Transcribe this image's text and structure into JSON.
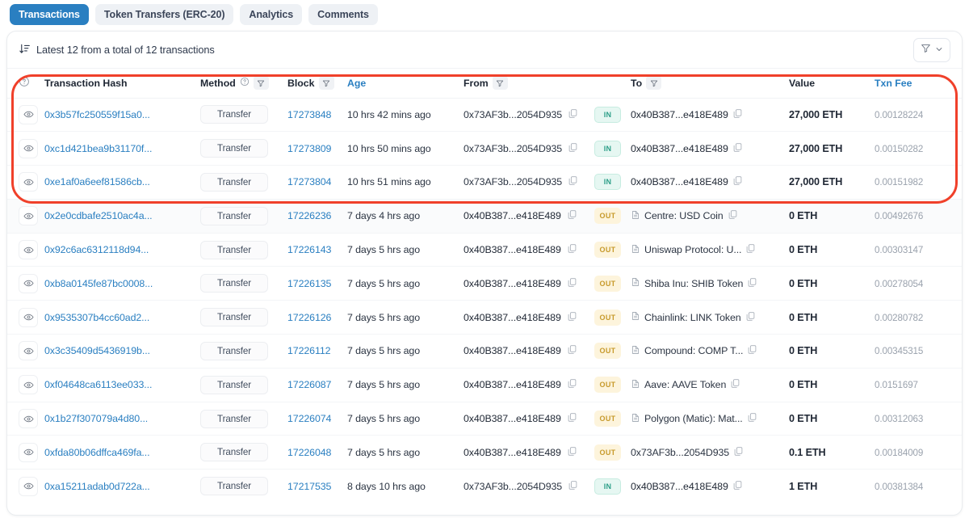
{
  "tabs": [
    {
      "label": "Transactions",
      "active": true
    },
    {
      "label": "Token Transfers (ERC-20)",
      "active": false
    },
    {
      "label": "Analytics",
      "active": false
    },
    {
      "label": "Comments",
      "active": false
    }
  ],
  "card": {
    "summary": "Latest 12 from a total of 12 transactions",
    "sort_icon": "sort-descending-icon",
    "filter_icon": "funnel-icon",
    "chevron_icon": "chevron-down-icon"
  },
  "table": {
    "headers": {
      "info": "",
      "hash": "Transaction Hash",
      "method": "Method",
      "block": "Block",
      "age": "Age",
      "from": "From",
      "dir": "",
      "to": "To",
      "value": "Value",
      "fee": "Txn Fee"
    },
    "rows": [
      {
        "hash": "0x3b57fc250559f15a0...",
        "method": "Transfer",
        "block": "17273848",
        "age": "10 hrs 42 mins ago",
        "from": "0x73AF3b...2054D935",
        "from_link": true,
        "dir": "IN",
        "to": "0x40B387...e418E489",
        "to_link": false,
        "to_is_token": false,
        "value": "27,000 ETH",
        "fee": "0.00128224",
        "highlight": false
      },
      {
        "hash": "0xc1d421bea9b31170f...",
        "method": "Transfer",
        "block": "17273809",
        "age": "10 hrs 50 mins ago",
        "from": "0x73AF3b...2054D935",
        "from_link": true,
        "dir": "IN",
        "to": "0x40B387...e418E489",
        "to_link": false,
        "to_is_token": false,
        "value": "27,000 ETH",
        "fee": "0.00150282",
        "highlight": false
      },
      {
        "hash": "0xe1af0a6eef81586cb...",
        "method": "Transfer",
        "block": "17273804",
        "age": "10 hrs 51 mins ago",
        "from": "0x73AF3b...2054D935",
        "from_link": true,
        "dir": "IN",
        "to": "0x40B387...e418E489",
        "to_link": false,
        "to_is_token": false,
        "value": "27,000 ETH",
        "fee": "0.00151982",
        "highlight": false
      },
      {
        "hash": "0x2e0cdbafe2510ac4a...",
        "method": "Transfer",
        "block": "17226236",
        "age": "7 days 4 hrs ago",
        "from": "0x40B387...e418E489",
        "from_link": false,
        "dir": "OUT",
        "to": "Centre: USD Coin",
        "to_link": true,
        "to_is_token": true,
        "value": "0 ETH",
        "fee": "0.00492676",
        "highlight": true
      },
      {
        "hash": "0x92c6ac6312118d94...",
        "method": "Transfer",
        "block": "17226143",
        "age": "7 days 5 hrs ago",
        "from": "0x40B387...e418E489",
        "from_link": false,
        "dir": "OUT",
        "to": "Uniswap Protocol: U...",
        "to_link": true,
        "to_is_token": true,
        "value": "0 ETH",
        "fee": "0.00303147",
        "highlight": false
      },
      {
        "hash": "0xb8a0145fe87bc0008...",
        "method": "Transfer",
        "block": "17226135",
        "age": "7 days 5 hrs ago",
        "from": "0x40B387...e418E489",
        "from_link": false,
        "dir": "OUT",
        "to": "Shiba Inu: SHIB Token",
        "to_link": true,
        "to_is_token": true,
        "value": "0 ETH",
        "fee": "0.00278054",
        "highlight": false
      },
      {
        "hash": "0x9535307b4cc60ad2...",
        "method": "Transfer",
        "block": "17226126",
        "age": "7 days 5 hrs ago",
        "from": "0x40B387...e418E489",
        "from_link": false,
        "dir": "OUT",
        "to": "Chainlink: LINK Token",
        "to_link": true,
        "to_is_token": true,
        "value": "0 ETH",
        "fee": "0.00280782",
        "highlight": false
      },
      {
        "hash": "0x3c35409d5436919b...",
        "method": "Transfer",
        "block": "17226112",
        "age": "7 days 5 hrs ago",
        "from": "0x40B387...e418E489",
        "from_link": false,
        "dir": "OUT",
        "to": "Compound: COMP T...",
        "to_link": true,
        "to_is_token": true,
        "value": "0 ETH",
        "fee": "0.00345315",
        "highlight": false
      },
      {
        "hash": "0xf04648ca6113ee033...",
        "method": "Transfer",
        "block": "17226087",
        "age": "7 days 5 hrs ago",
        "from": "0x40B387...e418E489",
        "from_link": false,
        "dir": "OUT",
        "to": "Aave: AAVE Token",
        "to_link": true,
        "to_is_token": true,
        "value": "0 ETH",
        "fee": "0.0151697",
        "highlight": false
      },
      {
        "hash": "0x1b27f307079a4d80...",
        "method": "Transfer",
        "block": "17226074",
        "age": "7 days 5 hrs ago",
        "from": "0x40B387...e418E489",
        "from_link": false,
        "dir": "OUT",
        "to": "Polygon (Matic): Mat...",
        "to_link": true,
        "to_is_token": true,
        "value": "0 ETH",
        "fee": "0.00312063",
        "highlight": false
      },
      {
        "hash": "0xfda80b06dffca469fa...",
        "method": "Transfer",
        "block": "17226048",
        "age": "7 days 5 hrs ago",
        "from": "0x40B387...e418E489",
        "from_link": false,
        "dir": "OUT",
        "to": "0x73AF3b...2054D935",
        "to_link": true,
        "to_is_token": false,
        "value": "0.1 ETH",
        "fee": "0.00184009",
        "highlight": false
      },
      {
        "hash": "0xa15211adab0d722a...",
        "method": "Transfer",
        "block": "17217535",
        "age": "8 days 10 hrs ago",
        "from": "0x73AF3b...2054D935",
        "from_link": true,
        "dir": "IN",
        "to": "0x40B387...e418E489",
        "to_link": false,
        "to_is_token": false,
        "value": "1 ETH",
        "fee": "0.00381384",
        "highlight": false
      }
    ]
  },
  "annotation": {
    "type": "red-rounded-rectangle",
    "color": "#f0402a"
  },
  "colors": {
    "accent_blue": "#2a7fc1",
    "in_badge_bg": "#e6f7f2",
    "in_badge_text": "#2b9e87",
    "out_badge_bg": "#fdf4dc",
    "out_badge_text": "#c79a2b",
    "annotation_red": "#f0402a"
  }
}
